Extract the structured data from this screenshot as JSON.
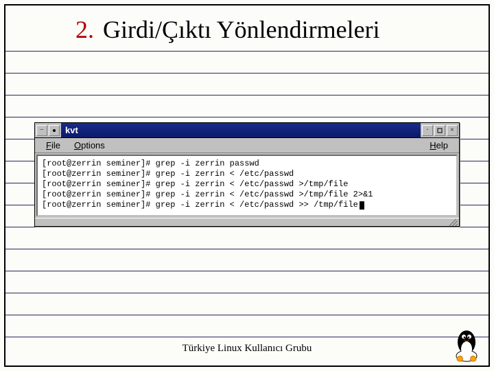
{
  "title": {
    "number": "2.",
    "text": "Girdi/Çıktı Yönlendirmeleri"
  },
  "window": {
    "app_title": "kvt",
    "menubar": {
      "file": "File",
      "options": "Options",
      "help": "Help"
    },
    "terminal_lines": [
      "[root@zerrin seminer]# grep -i zerrin passwd",
      "[root@zerrin seminer]# grep -i zerrin < /etc/passwd",
      "[root@zerrin seminer]# grep -i zerrin < /etc/passwd >/tmp/file",
      "[root@zerrin seminer]# grep -i zerrin < /etc/passwd >/tmp/file 2>&1",
      "[root@zerrin seminer]# grep -i zerrin < /etc/passwd >> /tmp/file"
    ]
  },
  "footer": "Türkiye Linux Kullanıcı Grubu",
  "ruled_line_tops": [
    74,
    106,
    138,
    170,
    202,
    234,
    266,
    298,
    330,
    362,
    394,
    426,
    458,
    490
  ]
}
